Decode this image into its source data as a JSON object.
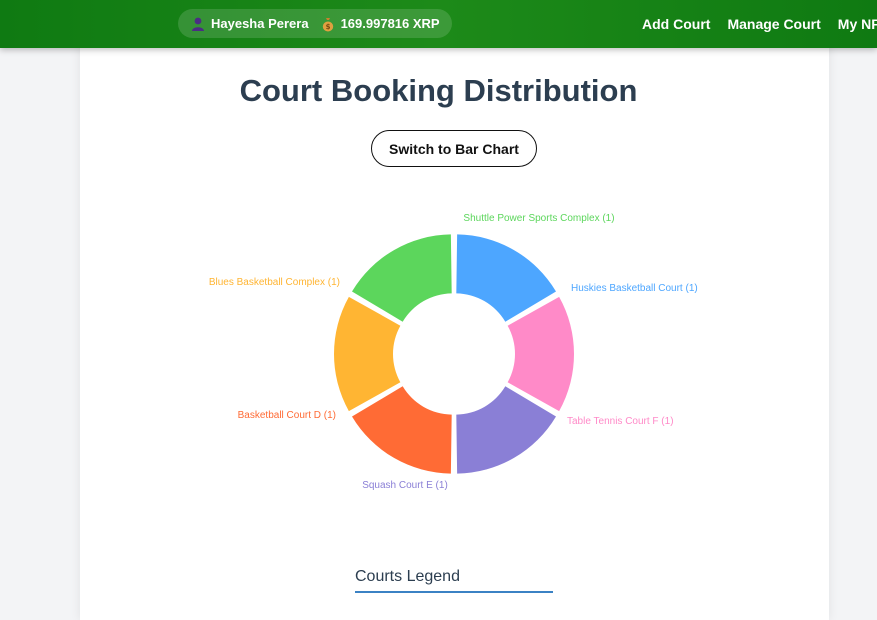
{
  "header": {
    "user_name": "Hayesha Perera",
    "balance": "169.997816 XRP",
    "user_icon": "user-icon",
    "wallet_icon": "money-bag-icon",
    "nav": [
      "Add Court",
      "Manage Court",
      "My NFTs"
    ]
  },
  "page": {
    "title": "Court Booking Distribution",
    "switch_button": "Switch to Bar Chart",
    "legend_title": "Courts Legend"
  },
  "chart_data": {
    "type": "pie",
    "variant": "doughnut",
    "slices": [
      {
        "label": "Shuttle Power Sports Complex (1)",
        "value": 1,
        "color": "#5cd65c"
      },
      {
        "label": "Huskies Basketball Court (1)",
        "value": 1,
        "color": "#4da6ff"
      },
      {
        "label": "Table Tennis Court F (1)",
        "value": 1,
        "color": "#ff8ac8"
      },
      {
        "label": "Squash Court E (1)",
        "value": 1,
        "color": "#8a7fd6"
      },
      {
        "label": "Basketball Court D (1)",
        "value": 1,
        "color": "#ff6b35"
      },
      {
        "label": "Blues Basketball Complex (1)",
        "value": 1,
        "color": "#ffb533"
      }
    ]
  }
}
